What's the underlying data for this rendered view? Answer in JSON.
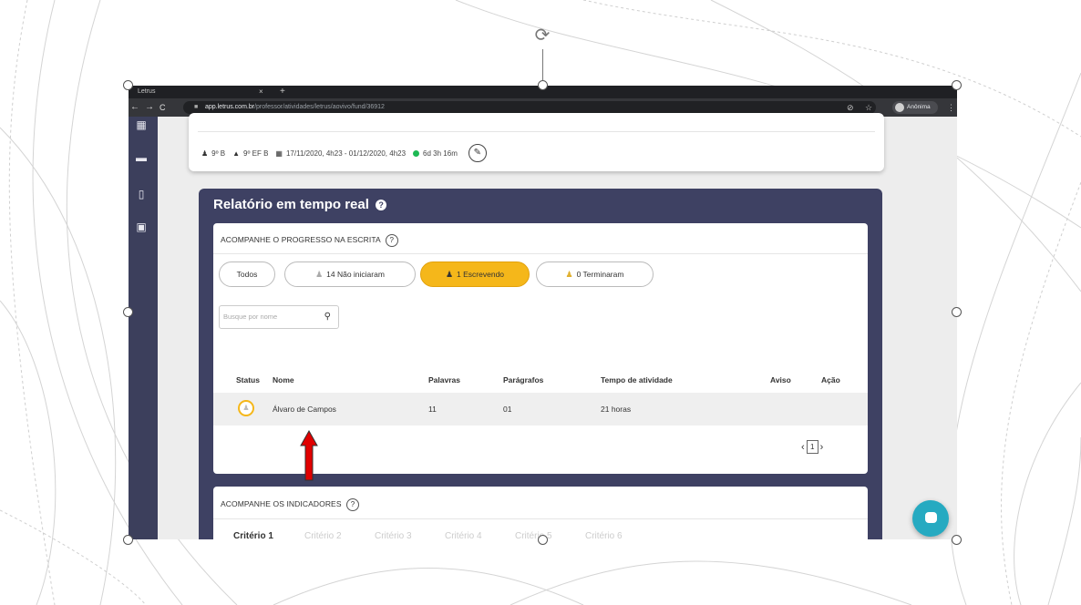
{
  "browser": {
    "tab_title": "Letrus",
    "tab_close": "×",
    "new_tab": "+",
    "url_host": "app.letrus.com.br",
    "url_path": "/professor/atividades/letrus/aovivo/fund/36912",
    "profile_name": "Anônima"
  },
  "activity_info": {
    "class_label": "9º B",
    "grade_label": "9º EF B",
    "period": "17/11/2020, 4h23 - 01/12/2020, 4h23",
    "remaining": "6d 3h 16m"
  },
  "report": {
    "title": "Relatório em tempo real",
    "help_icon": "?",
    "progress_panel": {
      "title": "ACOMPANHE O PROGRESSO NA ESCRITA",
      "help": "?",
      "filters": [
        {
          "label": "Todos",
          "active": false
        },
        {
          "label": "14 Não iniciaram",
          "active": false
        },
        {
          "label": "1 Escrevendo",
          "active": true
        },
        {
          "label": "0 Terminaram",
          "active": false
        }
      ],
      "search_placeholder": "Busque por nome",
      "columns": [
        "Status",
        "Nome",
        "Palavras",
        "Parágrafos",
        "Tempo de atividade",
        "Aviso",
        "Ação"
      ],
      "rows": [
        {
          "name": "Álvaro de Campos",
          "words": "11",
          "paragraphs": "01",
          "time": "21 horas"
        }
      ],
      "pager": {
        "prev": "‹",
        "page": "1",
        "next": "›"
      }
    },
    "indicators_panel": {
      "title": "ACOMPANHE OS INDICADORES",
      "help": "?",
      "criteria": [
        "Critério 1",
        "Critério 2",
        "Critério 3",
        "Critério 4",
        "Critério 5",
        "Critério 6"
      ]
    }
  },
  "colors": {
    "sidebar": "#3c3f5c",
    "report_bg": "#3e4163",
    "active_filter": "#f5b71a",
    "chat_button": "#26aac1",
    "annotation_arrow": "#e00000"
  }
}
